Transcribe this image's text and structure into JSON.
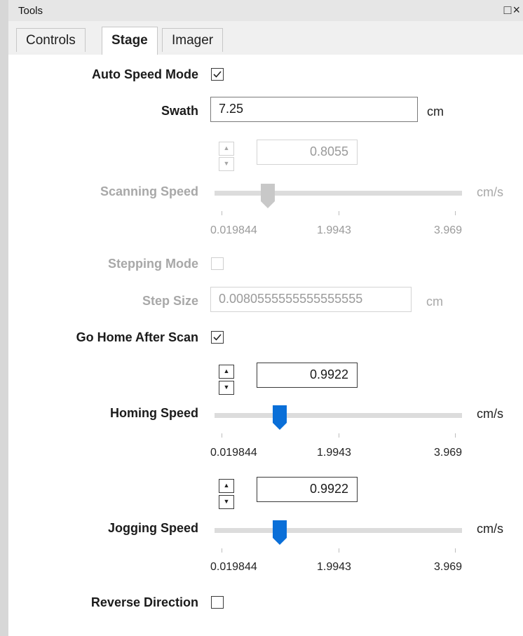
{
  "window": {
    "title": "Tools",
    "controls": "□×"
  },
  "tabs": [
    {
      "label": "Controls",
      "active": false
    },
    {
      "label": "Stage",
      "active": true
    },
    {
      "label": "Imager",
      "active": false
    }
  ],
  "auto_speed_mode": {
    "label": "Auto Speed Mode",
    "checked": true
  },
  "swath": {
    "label": "Swath",
    "value": "7.25",
    "unit": "cm"
  },
  "scanning_speed": {
    "label": "Scanning Speed",
    "value": "0.8055",
    "unit": "cm/s",
    "enabled": false,
    "min": "0.019844",
    "mid": "1.9943",
    "max": "3.969"
  },
  "stepping_mode": {
    "label": "Stepping Mode",
    "checked": false,
    "enabled": false
  },
  "step_size": {
    "label": "Step Size",
    "value": "0.0080555555555555555",
    "unit": "cm",
    "enabled": false
  },
  "go_home_after_scan": {
    "label": "Go Home After Scan",
    "checked": true
  },
  "homing_speed": {
    "label": "Homing Speed",
    "value": "0.9922",
    "unit": "cm/s",
    "min": "0.019844",
    "mid": "1.9943",
    "max": "3.969"
  },
  "jogging_speed": {
    "label": "Jogging Speed",
    "value": "0.9922",
    "unit": "cm/s",
    "min": "0.019844",
    "mid": "1.9943",
    "max": "3.969"
  },
  "reverse_direction": {
    "label": "Reverse Direction",
    "checked": false
  },
  "spinner_glyphs": {
    "up": "▲",
    "down": "▼"
  },
  "colors": {
    "thumb_active": "#0a6fd8",
    "thumb_disabled": "#c8c8c8",
    "track": "#dcdcdc",
    "disabled_text": "#a8a8a8"
  }
}
